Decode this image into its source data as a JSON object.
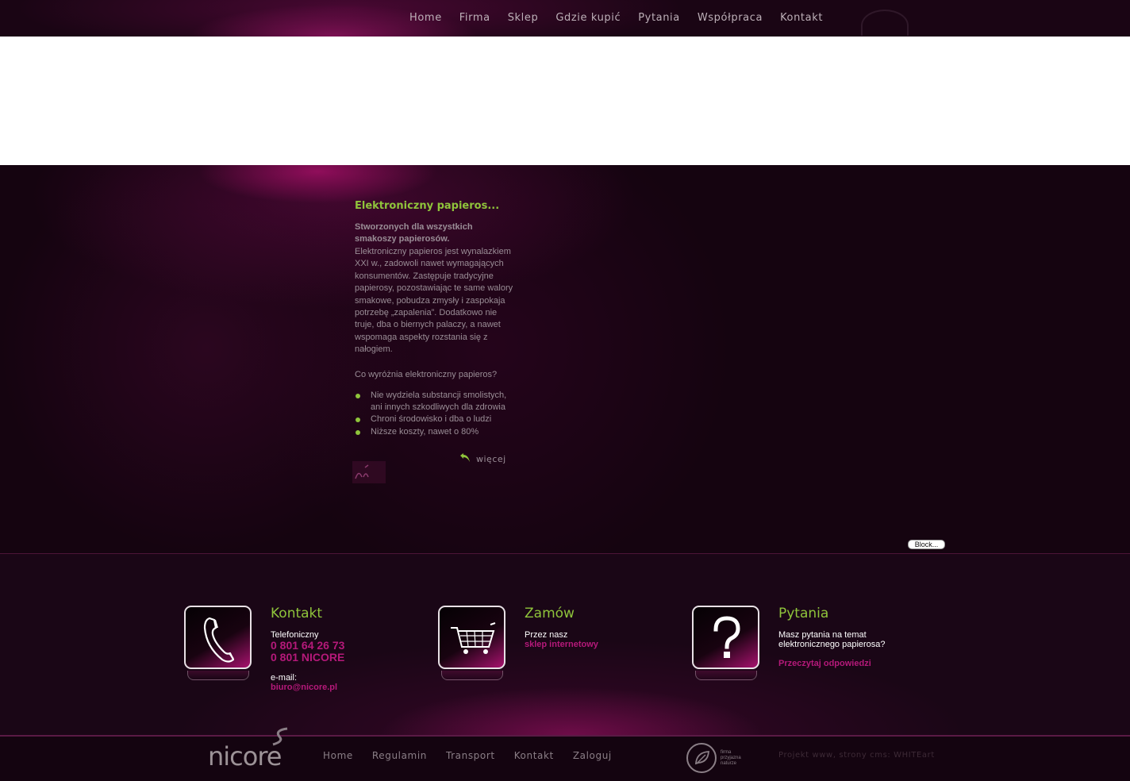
{
  "topnav": {
    "items": [
      "Home",
      "Firma",
      "Sklep",
      "Gdzie kupić",
      "Pytania",
      "Współpraca",
      "Kontakt"
    ]
  },
  "article": {
    "title": "Elektroniczny papieros...",
    "lead": "Stworzonych dla wszystkich smakoszy papierosów.",
    "body": "Elektroniczny papieros jest wynalazkiem XXI w., zadowoli nawet wymagających konsumentów.  Zastępuje tradycyjne papierosy, pozostawiając te same walory smakowe, pobudza zmysły i zaspokaja potrzebę „zapalenia”. Dodatkowo nie truje, dba o biernych palaczy, a nawet wspomaga aspekty rozstania się z nałogiem.",
    "question": "Co wyróżnia elektroniczny papieros?",
    "bullets": [
      "Nie wydziela substancji smolistych, ani innych szkodliwych dla zdrowia",
      "Chroni środowisko i dba o ludzi",
      "Niższe koszty, nawet o 80%"
    ],
    "more": "więcej"
  },
  "block_button": "Block...",
  "boxes": {
    "contact": {
      "title": "Kontakt",
      "phone_label": "Telefoniczny",
      "phone1": "0 801 64 26 73",
      "phone2": "0 801 NICORE",
      "email_label": "e-mail:",
      "email": "biuro@nicore.pl"
    },
    "order": {
      "title": "Zamów",
      "text": "Przez nasz",
      "link": "sklep internetowy"
    },
    "faq": {
      "title": "Pytania",
      "text1": "Masz pytania na temat",
      "text2": "elektronicznego papierosa?",
      "link": "Przeczytaj odpowiedzi"
    }
  },
  "footer": {
    "logo": "nicore",
    "nav": [
      "Home",
      "Regulamin",
      "Transport",
      "Kontakt",
      "Zaloguj"
    ],
    "eco_label": [
      "firma",
      "przyjazna",
      "naturze"
    ],
    "credit": "Projekt www, strony cms: WHITEart"
  },
  "colors": {
    "accent_green": "#8fc43b",
    "accent_pink": "#b5197a",
    "background": "#140410"
  }
}
